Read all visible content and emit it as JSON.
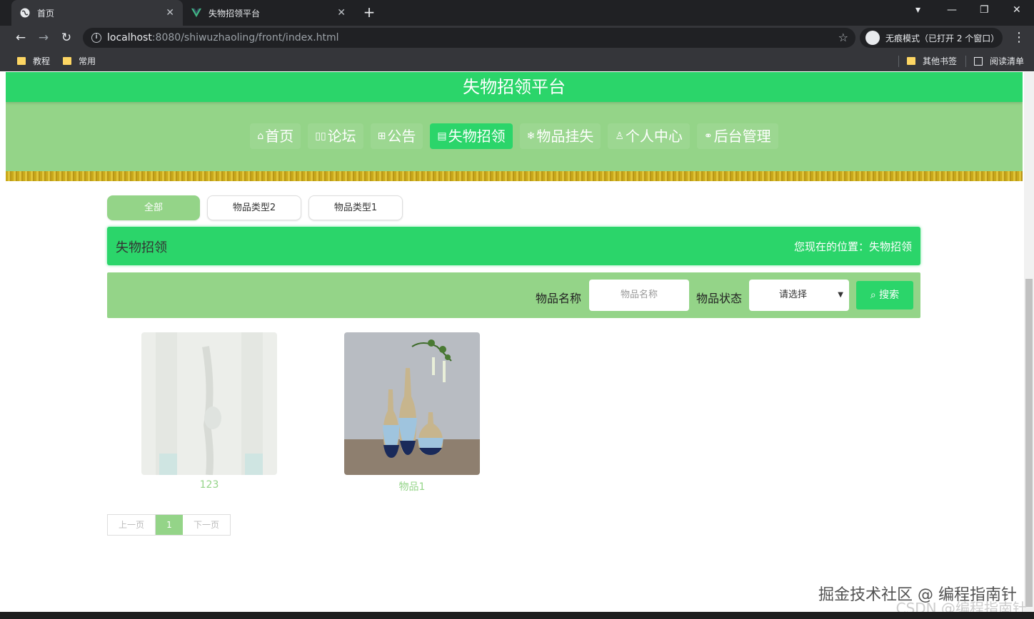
{
  "browser": {
    "tabs": [
      {
        "title": "首页",
        "active": true
      },
      {
        "title": "失物招领平台",
        "active": false
      }
    ],
    "url_host": "localhost",
    "url_path": ":8080/shiwuzhaoling/front/index.html",
    "incognito_label": "无痕模式（已打开 2 个窗口）",
    "bookmarks": [
      "教程",
      "常用"
    ],
    "other_bookmarks": "其他书签",
    "reading_list": "阅读清单"
  },
  "site": {
    "title": "失物招领平台",
    "nav": [
      {
        "label": "首页",
        "icon": "home-icon",
        "glyph": "⌂",
        "active": false
      },
      {
        "label": "论坛",
        "icon": "forum-icon",
        "glyph": "▯▯",
        "active": false
      },
      {
        "label": "公告",
        "icon": "announcement-icon",
        "glyph": "⊞",
        "active": false
      },
      {
        "label": "失物招领",
        "icon": "document-icon",
        "glyph": "▤",
        "active": true
      },
      {
        "label": "物品挂失",
        "icon": "snowflake-icon",
        "glyph": "❄",
        "active": false
      },
      {
        "label": "个人中心",
        "icon": "user-icon",
        "glyph": "♙",
        "active": false
      },
      {
        "label": "后台管理",
        "icon": "link-icon",
        "glyph": "🔗",
        "active": false
      }
    ]
  },
  "categories": [
    {
      "label": "全部",
      "active": true
    },
    {
      "label": "物品类型2",
      "active": false
    },
    {
      "label": "物品类型1",
      "active": false
    }
  ],
  "crumb": {
    "title": "失物招领",
    "position": "您现在的位置：失物招领"
  },
  "search": {
    "name_label": "物品名称",
    "name_placeholder": "物品名称",
    "status_label": "物品状态",
    "status_selected": "请选择",
    "button": "搜索"
  },
  "items": [
    {
      "name": "123"
    },
    {
      "name": "物品1"
    }
  ],
  "pager": {
    "prev": "上一页",
    "current": "1",
    "next": "下一页"
  },
  "watermark": "掘金技术社区 @ 编程指南针",
  "watermark2": "CSDN @编程指南针",
  "colors": {
    "primary": "#2bd56a",
    "light": "#94d488"
  }
}
